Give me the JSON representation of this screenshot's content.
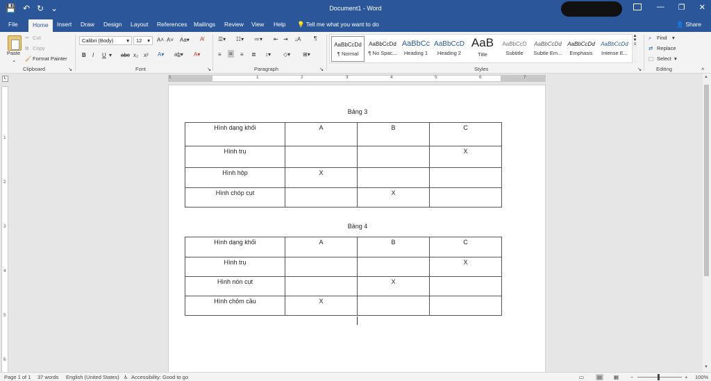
{
  "window": {
    "title": "Document1  -  Word",
    "quick_access": [
      "💾",
      "↶",
      "↻",
      "⌄"
    ],
    "controls": [
      "—",
      "❐",
      "✕"
    ]
  },
  "tabs": [
    "File",
    "Home",
    "Insert",
    "Draw",
    "Design",
    "Layout",
    "References",
    "Mailings",
    "Review",
    "View",
    "Help"
  ],
  "tell_me": "Tell me what you want to do",
  "share": "Share",
  "clipboard": {
    "paste": "Paste",
    "cut": "Cut",
    "copy": "Copy",
    "format_painter": "Format Painter",
    "label": "Clipboard"
  },
  "font": {
    "name": "Calibri (Body)",
    "size": "12",
    "label": "Font",
    "buttons": [
      "B",
      "I",
      "U",
      "abc",
      "x₂",
      "x²"
    ]
  },
  "paragraph": {
    "label": "Paragraph"
  },
  "styles": {
    "label": "Styles",
    "items": [
      {
        "preview": "AaBbCcDd",
        "name": "¶ Normal"
      },
      {
        "preview": "AaBbCcDd",
        "name": "¶ No Spac..."
      },
      {
        "preview": "AaBbCc",
        "name": "Heading 1"
      },
      {
        "preview": "AaBbCcD",
        "name": "Heading 2"
      },
      {
        "preview": "AaB",
        "name": "Title"
      },
      {
        "preview": "AaBbCcD",
        "name": "Subtitle"
      },
      {
        "preview": "AaBbCcDd",
        "name": "Subtle Em..."
      },
      {
        "preview": "AaBbCcDd",
        "name": "Emphasis"
      },
      {
        "preview": "AaBbCcDd",
        "name": "Intense E..."
      }
    ]
  },
  "editing": {
    "find": "Find",
    "replace": "Replace",
    "select": "Select",
    "label": "Editing"
  },
  "ruler": {
    "h_numbers": [
      "1",
      "1",
      "2",
      "3",
      "4",
      "5",
      "6",
      "7"
    ],
    "v_numbers": [
      "1",
      "2",
      "3",
      "4",
      "5",
      "6"
    ]
  },
  "document": {
    "table1": {
      "caption": "Bảng 3",
      "rows": [
        [
          "Hình dạng khối",
          "A",
          "B",
          "C"
        ],
        [
          "Hình trụ",
          "",
          "",
          "X"
        ],
        [
          "Hình hộp",
          "X",
          "",
          ""
        ],
        [
          "Hình chóp cụt",
          "",
          "X",
          ""
        ]
      ]
    },
    "table2": {
      "caption": "Bảng 4",
      "rows": [
        [
          "Hình dạng khối",
          "A",
          "B",
          "C"
        ],
        [
          "Hình trụ",
          "",
          "",
          "X"
        ],
        [
          "Hình nón cụt",
          "",
          "X",
          ""
        ],
        [
          "Hình chỏm cầu",
          "X",
          "",
          ""
        ]
      ]
    }
  },
  "status": {
    "page": "Page 1 of 1",
    "words": "37 words",
    "language": "English (United States)",
    "accessibility": "Accessibility: Good to go",
    "zoom": "100%"
  }
}
